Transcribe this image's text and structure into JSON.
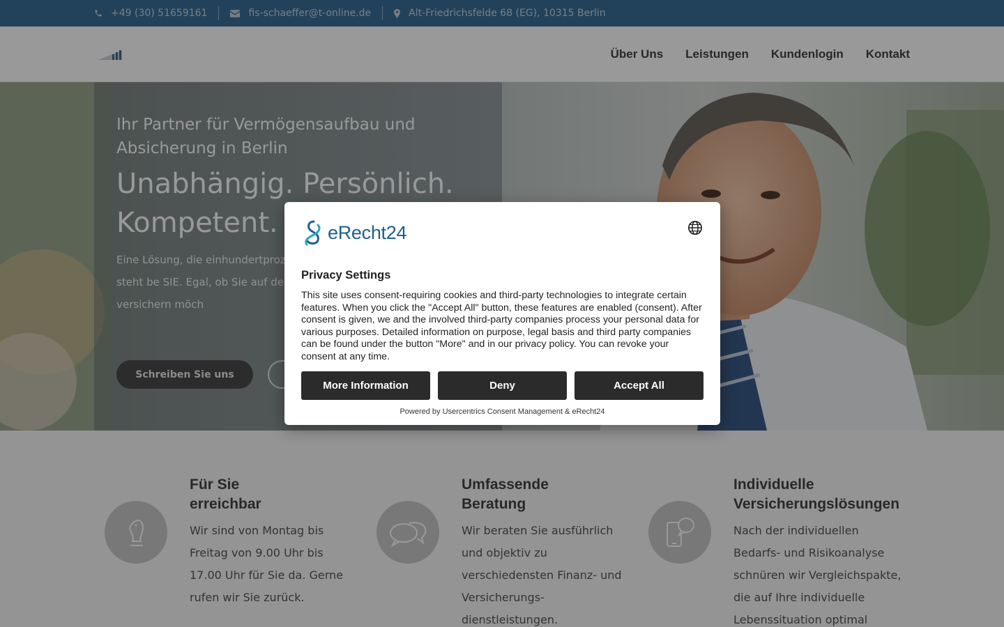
{
  "topbar": {
    "phone": "+49 (30) 51659161",
    "email": "fis-schaeffer@t-online.de",
    "address": "Alt-Friedrichsfelde 68 (EG), 10315 Berlin"
  },
  "nav": {
    "items": [
      "Über Uns",
      "Leistungen",
      "Kundenlogin",
      "Kontakt"
    ]
  },
  "hero": {
    "subtitle": "Ihr Partner für Vermögensaufbau und Absicherung in Berlin",
    "title": "Unabhängig. Persönlich. Kompetent.",
    "text": "Eine Lösung, die einhundertproz Richtige für Sie. Deshalb steht be SIE. Egal, ob Sie auf der Suche na vorsorgen oder versichern möch",
    "cta_primary": "Schreiben Sie uns"
  },
  "features": [
    {
      "title": "Für Sie erreichbar",
      "title_lines": [
        "Für Sie",
        "erreichbar"
      ],
      "icon": "chess-knight-icon",
      "text": "Wir sind von Montag bis Freitag von 9.00 Uhr bis 17.00 Uhr für Sie da. Gerne rufen wir Sie zurück."
    },
    {
      "title": "Umfassende Beratung",
      "title_lines": [
        "Umfassende",
        "Beratung"
      ],
      "icon": "chat-bubbles-icon",
      "text": "Wir beraten Sie ausführlich und objektiv zu verschiedensten Finanz- und Versicherungs-dienstleistungen."
    },
    {
      "title": "Individuelle Versicherungslösungen",
      "title_lines": [
        "Individuelle",
        "Versicherungslösungen"
      ],
      "icon": "phone-chat-icon",
      "text": "Nach der individuellen Bedarfs- und Risikoanalyse schnüren wir Vergleichspakte, die auf Ihre individuelle Lebenssituation optimal zugeschnitten sind."
    }
  ],
  "consent": {
    "brand": "eRecht24",
    "title": "Privacy Settings",
    "description": "This site uses consent-requiring cookies and third-party technologies to integrate certain features. When you click the \"Accept All\" button, these features are enabled (consent). After consent is given, we and the involved third-party companies process your personal data for various purposes. Detailed information on purpose, legal basis and third party companies can be found under the button \"More\" and in our privacy policy. You can revoke your consent at any time.",
    "more_label": "More Information",
    "deny_label": "Deny",
    "accept_label": "Accept All",
    "powered_by": "Powered by Usercentrics Consent Management & eRecht24"
  },
  "colors": {
    "topbar": "#3a6f99",
    "button_dark": "#2b2b2b",
    "brand_blue": "#1f5f8b",
    "brand_teal": "#2aa6b8"
  }
}
